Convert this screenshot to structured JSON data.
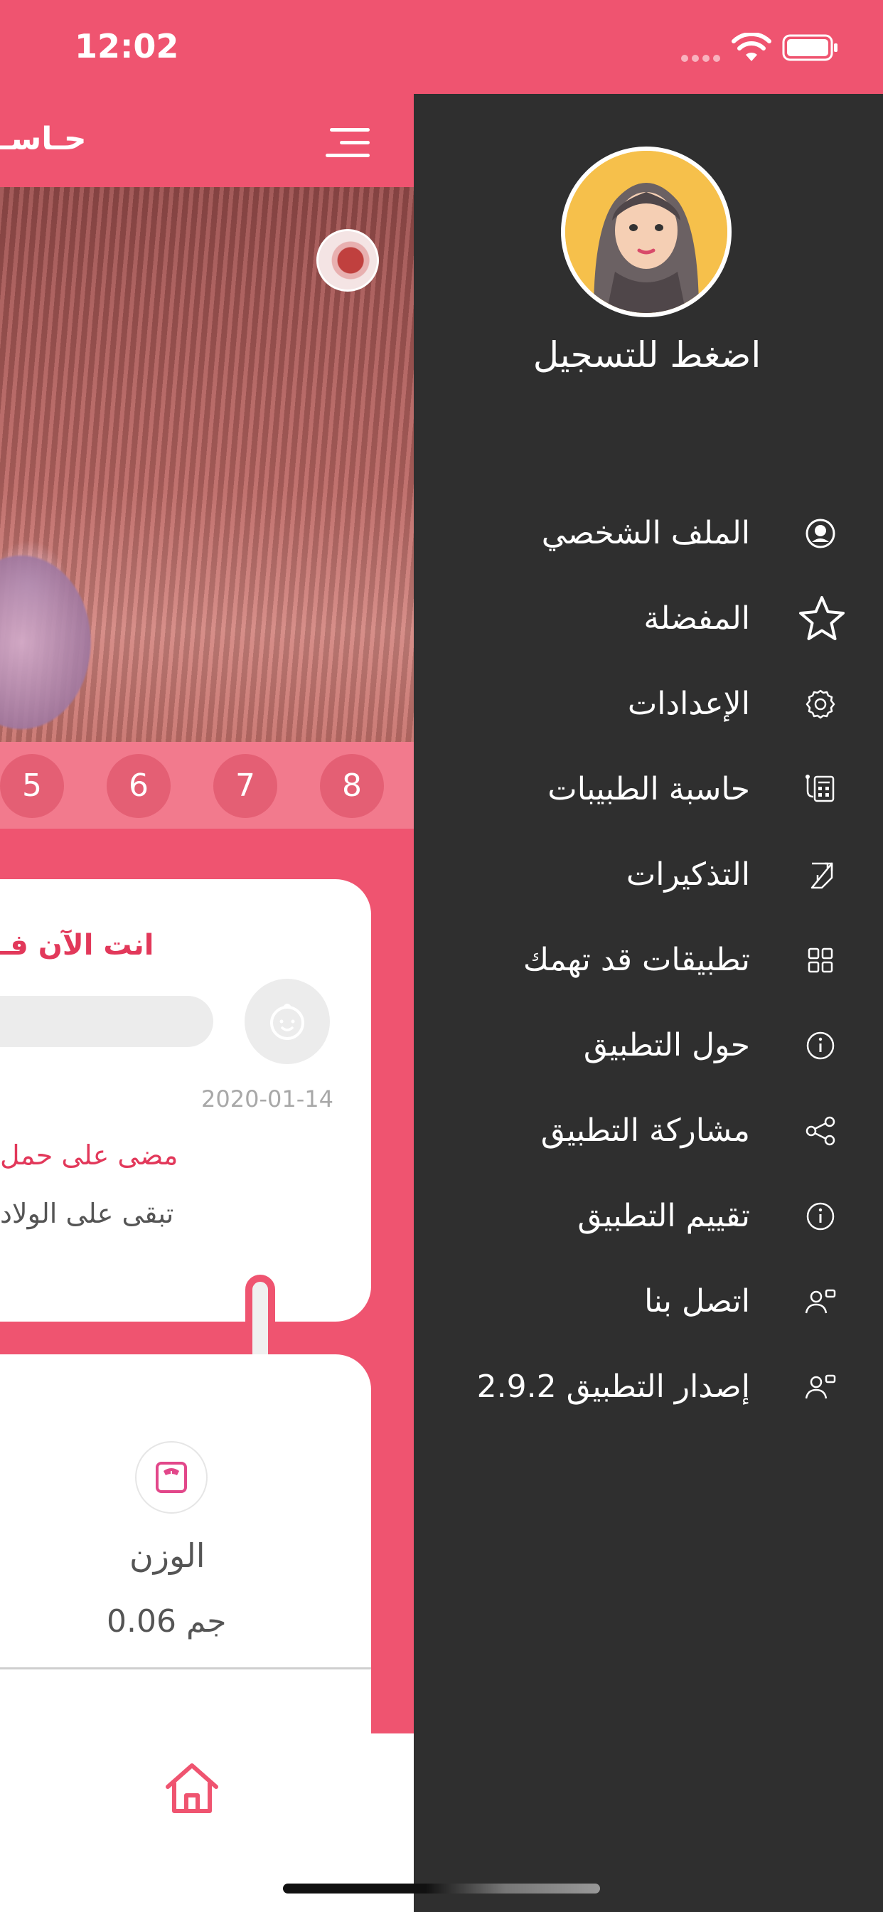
{
  "status_bar": {
    "time": "12:02"
  },
  "main": {
    "header_title": "حـاسـ",
    "weeks": [
      "5",
      "6",
      "7",
      "8"
    ],
    "progress_card": {
      "title": "انت الآن فـ",
      "date": "2020-01-14",
      "passed_text": "مضى على حمل",
      "remaining_text": "تبقى على الولاد"
    },
    "weight_card": {
      "label": "الوزن",
      "value": "0.06 جم"
    }
  },
  "drawer": {
    "register_label": "اضغط للتسجيل",
    "menu_items": [
      {
        "label": "الملف الشخصي",
        "icon": "profile-icon"
      },
      {
        "label": "المفضلة",
        "icon": "star-icon"
      },
      {
        "label": "الإعدادات",
        "icon": "gear-icon"
      },
      {
        "label": "حاسبة الطبيبات",
        "icon": "calculator-icon"
      },
      {
        "label": "التذكيرات",
        "icon": "reminder-icon"
      },
      {
        "label": "تطبيقات قد تهمك",
        "icon": "grid-icon"
      },
      {
        "label": "حول التطبيق",
        "icon": "info-icon"
      },
      {
        "label": "مشاركة التطبيق",
        "icon": "share-icon"
      },
      {
        "label": "تقييم التطبيق",
        "icon": "info-icon"
      },
      {
        "label": "اتصل بنا",
        "icon": "contact-icon"
      },
      {
        "label": "إصدار التطبيق 2.9.2",
        "icon": "contact-icon"
      }
    ]
  },
  "colors": {
    "accent": "#ef5470",
    "accent_light": "#f27a8d",
    "drawer_bg": "#2f2f2f",
    "accent_text": "#e2385a"
  }
}
